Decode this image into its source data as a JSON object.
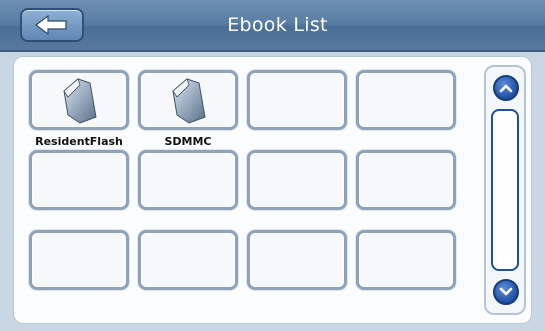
{
  "header": {
    "title": "Ebook List",
    "back_icon": "arrow-left-icon",
    "accent": "#5a7ea4"
  },
  "items": [
    {
      "label": "ResidentFlash",
      "icon": "storage-card-icon"
    },
    {
      "label": "SDMMC",
      "icon": "storage-card-icon"
    },
    {
      "label": ""
    },
    {
      "label": ""
    },
    {
      "label": ""
    },
    {
      "label": ""
    },
    {
      "label": ""
    },
    {
      "label": ""
    },
    {
      "label": ""
    },
    {
      "label": ""
    },
    {
      "label": ""
    },
    {
      "label": ""
    }
  ],
  "scrollbar": {
    "up_icon": "chevron-up-icon",
    "down_icon": "chevron-down-icon",
    "accent": "#1f4fa3"
  }
}
